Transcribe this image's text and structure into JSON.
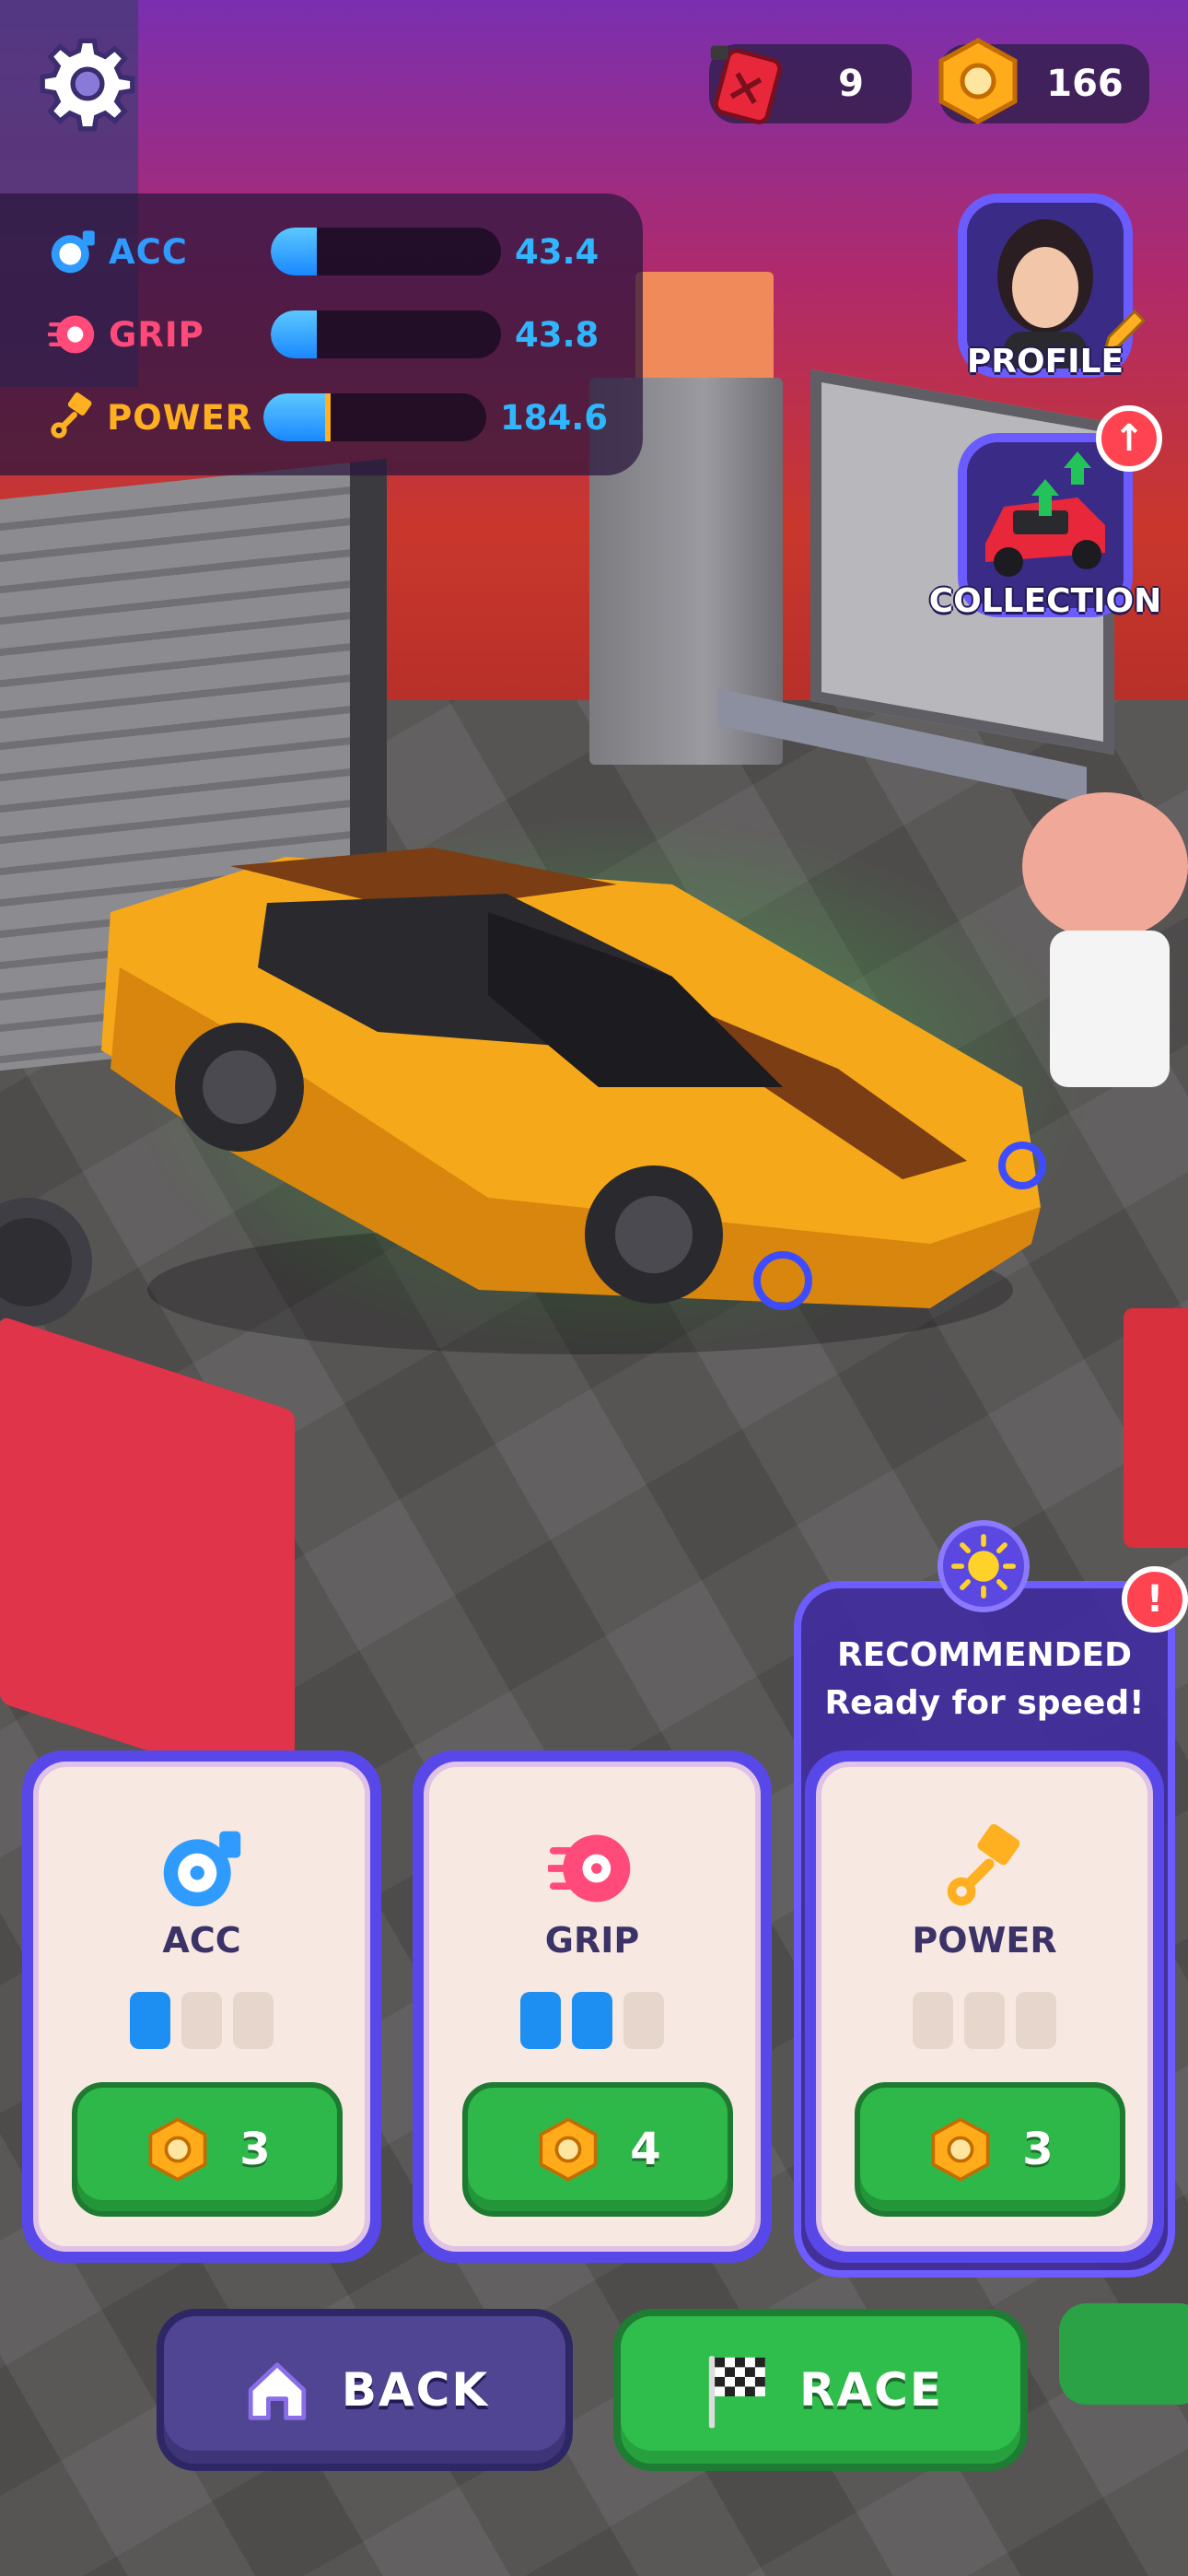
{
  "colors": {
    "acc": "#2f9bff",
    "grip": "#ff4a7a",
    "power": "#ffb020",
    "stat_value": "#2fb6ff",
    "green_button": "#2fb84a",
    "back_button": "#4f4592",
    "pip_filled": "#1e8ff2",
    "pip_empty": "#e7d6cc"
  },
  "hud": {
    "settings_icon": "gear-icon",
    "fuel": {
      "icon": "fuel-can-icon",
      "value": "9"
    },
    "nuts": {
      "icon": "hex-nut-icon",
      "value": "166"
    }
  },
  "stats": [
    {
      "icon": "turbo-icon",
      "label": "ACC",
      "value": "43.4",
      "fill_fraction": 0.2,
      "label_color": "#2f9bff"
    },
    {
      "icon": "brake-disc-icon",
      "label": "GRIP",
      "value": "43.8",
      "fill_fraction": 0.2,
      "label_color": "#ff4a7a"
    },
    {
      "icon": "piston-icon",
      "label": "POWER",
      "value": "184.6",
      "fill_fraction": 0.3,
      "label_color": "#ffb020"
    }
  ],
  "side": {
    "profile": {
      "label": "PROFILE",
      "icon": "avatar-icon"
    },
    "collection": {
      "label": "COLLECTION",
      "icon": "car-upgrade-icon",
      "badge": "↑"
    }
  },
  "recommended": {
    "title": "RECOMMENDED",
    "subtitle": "Ready for speed!",
    "badge": "!"
  },
  "upgrades": [
    {
      "name": "ACC",
      "icon": "turbo-icon",
      "level": 1,
      "max_level": 3,
      "cost": "3"
    },
    {
      "name": "GRIP",
      "icon": "brake-disc-icon",
      "level": 2,
      "max_level": 3,
      "cost": "4"
    },
    {
      "name": "POWER",
      "icon": "piston-icon",
      "level": 0,
      "max_level": 3,
      "cost": "3"
    }
  ],
  "buttons": {
    "back": "BACK",
    "race": "RACE"
  }
}
